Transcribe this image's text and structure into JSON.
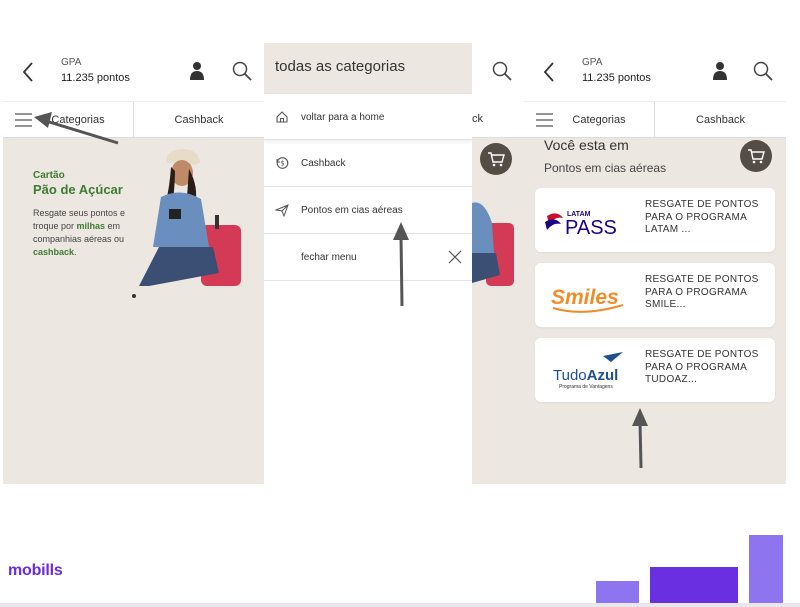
{
  "screen": {
    "store_name": "GPA",
    "points": "11.235 pontos",
    "tabs": {
      "categories": "Categorias",
      "cashback": "Cashback"
    }
  },
  "banner": {
    "line1": "Cartão",
    "line2": "Pão de Açúcar",
    "text_a": "Resgate seus pontos e troque por ",
    "text_b": "milhas",
    "text_c": " em companhias aéreas ou ",
    "text_d": "cashback",
    "text_e": "."
  },
  "menu": {
    "title": "todas as categorias",
    "items": [
      {
        "label": "voltar para a home",
        "icon": "home-icon"
      },
      {
        "label": "Cashback",
        "icon": "cashback-icon"
      },
      {
        "label": "Pontos em cias aéreas",
        "icon": "airplane-icon"
      },
      {
        "label": "fechar menu",
        "icon": "close-icon"
      }
    ],
    "peek_tab": "ck"
  },
  "results": {
    "title": "Você esta em",
    "subtitle": "Pontos em cias aéreas",
    "cards": [
      {
        "logo_top": "LATAM",
        "logo_main": "PASS",
        "desc": "RESGATE DE PONTOS PARA O PROGRAMA LATAM ..."
      },
      {
        "logo_main": "Smiles",
        "desc": "RESGATE DE PONTOS PARA O PROGRAMA SMILE..."
      },
      {
        "logo_a": "Tudo",
        "logo_b": "Azul",
        "logo_sub": "Programa de Vantagens",
        "desc": "RESGATE DE PONTOS PARA O PROGRAMA TUDOAZ..."
      }
    ]
  },
  "footer": {
    "brand": "mobills"
  },
  "colors": {
    "brand_purple": "#6c2be0",
    "bar_light": "#8f74f0",
    "bar_dark": "#6a2fe0",
    "cart_bg": "#544d46",
    "banner_green": "#3f7a33"
  }
}
